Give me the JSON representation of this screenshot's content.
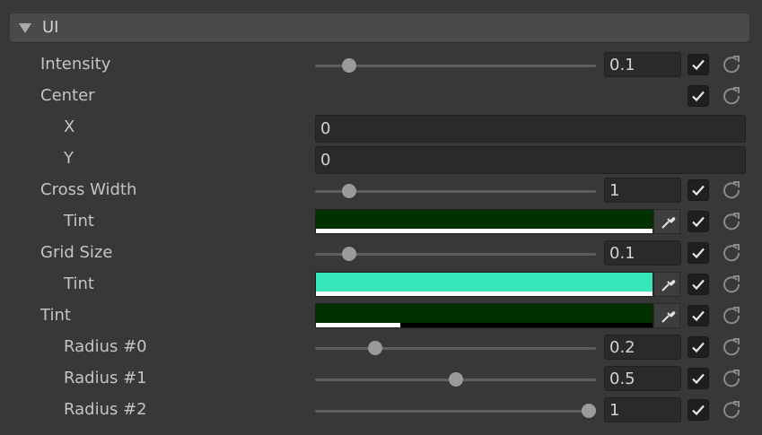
{
  "section": {
    "title": "UI",
    "expand_icon": "triangle-down-icon"
  },
  "colors": {
    "dark_green": "#003200",
    "teal": "#36e6b8"
  },
  "rows": {
    "intensity": {
      "label": "Intensity",
      "value": "0.1",
      "slider_fraction": 0.1
    },
    "center": {
      "label": "Center"
    },
    "x": {
      "label": "X",
      "value": "0"
    },
    "y": {
      "label": "Y",
      "value": "0"
    },
    "cross_width": {
      "label": "Cross Width",
      "value": "1",
      "slider_fraction": 0.1
    },
    "cross_tint": {
      "label": "Tint",
      "alpha": 1.0
    },
    "grid_size": {
      "label": "Grid Size",
      "value": "0.1",
      "slider_fraction": 0.1
    },
    "grid_tint": {
      "label": "Tint",
      "alpha": 1.0
    },
    "tint": {
      "label": "Tint",
      "alpha": 0.25
    },
    "radius0": {
      "label": "Radius #0",
      "value": "0.2",
      "slider_fraction": 0.2
    },
    "radius1": {
      "label": "Radius #1",
      "value": "0.5",
      "slider_fraction": 0.5
    },
    "radius2": {
      "label": "Radius #2",
      "value": "1",
      "slider_fraction": 1.0
    }
  }
}
